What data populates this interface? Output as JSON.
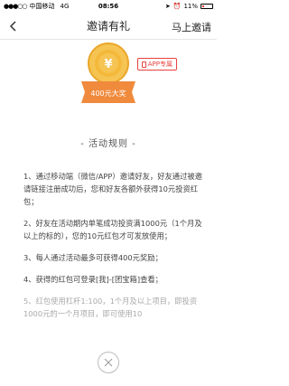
{
  "status": {
    "carrier": "中国移动",
    "network": "4G",
    "time": "08:56",
    "battery": "11%"
  },
  "nav": {
    "title": "邀请有礼",
    "right_action": "马上邀请"
  },
  "hero": {
    "app_tag": "APP专属",
    "medal_text": "400元大奖",
    "medal_symbol": "¥"
  },
  "rules": {
    "title": "- 活动规则 -",
    "items": [
      "1、通过移动端（微信/APP）邀请好友，好友通过被邀请链接注册成功后，您和好友各额外获得10元投资红包；",
      "2、好友在活动期内单笔成功投资满1000元（1个月及以上的标的），您的10元红包才可发放使用；",
      "3、每人通过活动最多可获得400元奖励；",
      "4、获得的红包可登录[我]-[团宝箱]查看；",
      "5、红包使用杠杆1:100，1个月及以上项目，即投资1000元的一个月项目，即可使用10"
    ]
  },
  "colors": {
    "accent": "#e8413e",
    "medal_gold": "#f4b93a",
    "ribbon_orange": "#f08a3c"
  }
}
